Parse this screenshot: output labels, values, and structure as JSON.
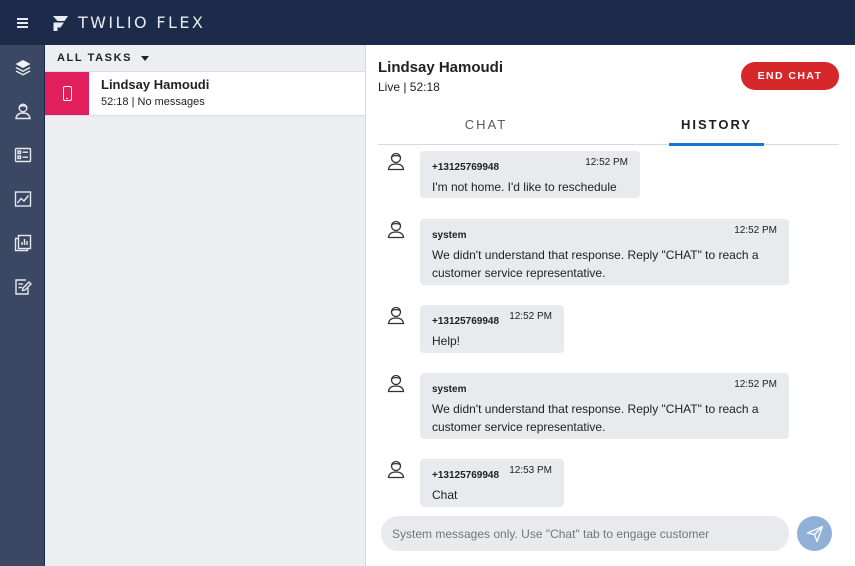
{
  "app": {
    "title": "TWILIO FLEX"
  },
  "colors": {
    "header_bg": "#1c2b4a",
    "sidenav_bg": "#3a4863",
    "channel_sms": "#e01f5c",
    "end_chat": "#d6282a",
    "tab_active": "#1976d2",
    "send_disabled": "#8fb1d8"
  },
  "sidenav": {
    "items": [
      {
        "icon": "layers-icon"
      },
      {
        "icon": "agents-icon"
      },
      {
        "icon": "queues-icon"
      },
      {
        "icon": "insights-icon"
      },
      {
        "icon": "reports-icon"
      },
      {
        "icon": "edit-icon"
      }
    ]
  },
  "tasklist": {
    "filter_label": "ALL TASKS",
    "tasks": [
      {
        "name": "Lindsay Hamoudi",
        "meta": "52:18 | No messages",
        "channel_icon": "sms-phone-icon"
      }
    ]
  },
  "panel": {
    "customer_name": "Lindsay Hamoudi",
    "status": "Live | 52:18",
    "end_chat_label": "END CHAT",
    "tabs": [
      {
        "label": "CHAT"
      },
      {
        "label": "HISTORY"
      }
    ],
    "active_tab": "HISTORY"
  },
  "messages": [
    {
      "author": "+13125769948",
      "time": "12:52 PM",
      "text": "I'm not home. I'd like to reschedule"
    },
    {
      "author": "system",
      "time": "12:52 PM",
      "text": "We didn't understand that response. Reply \"CHAT\" to reach a customer service representative."
    },
    {
      "author": "+13125769948",
      "time": "12:52 PM",
      "text": "Help!"
    },
    {
      "author": "system",
      "time": "12:52 PM",
      "text": "We didn't understand that response. Reply \"CHAT\" to reach a customer service representative."
    },
    {
      "author": "+13125769948",
      "time": "12:53 PM",
      "text": "Chat"
    }
  ],
  "composer": {
    "placeholder": "System messages only. Use \"Chat\" tab to engage customer",
    "send_icon": "send-icon"
  }
}
